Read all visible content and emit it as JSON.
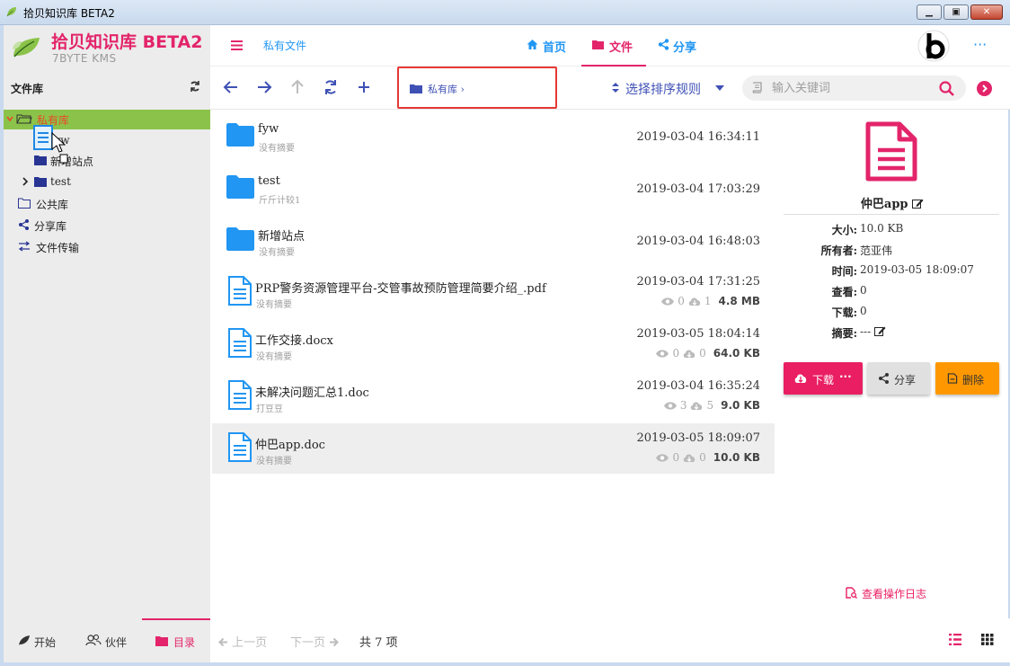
{
  "window": {
    "title": "拾贝知识库 BETA2",
    "minimize": "▁",
    "maximize": "▣",
    "close": "✕"
  },
  "brand": {
    "name": "拾贝知识库 BETA2",
    "subtitle": "7BYTE KMS"
  },
  "sidebar": {
    "heading": "文件库",
    "tree": [
      {
        "label": "私有库",
        "selected": true
      },
      {
        "label": "fyw"
      },
      {
        "label": "新增站点"
      },
      {
        "label": "test"
      },
      {
        "label": "公共库"
      },
      {
        "label": "分享库"
      },
      {
        "label": "文件传输"
      }
    ],
    "bottom_tabs": [
      {
        "label": "开始"
      },
      {
        "label": "伙伴"
      },
      {
        "label": "目录",
        "active": true
      }
    ]
  },
  "header": {
    "breadcrumb": "私有文件",
    "tabs": [
      {
        "label": "首页"
      },
      {
        "label": "文件",
        "active": true
      },
      {
        "label": "分享"
      }
    ],
    "more": "···"
  },
  "toolbar": {
    "path": "私有库",
    "path_sep": "›",
    "sort_label": "选择排序规则",
    "search_placeholder": "输入关键词"
  },
  "files": [
    {
      "type": "folder",
      "name": "fyw",
      "desc": "没有摘要",
      "date": "2019-03-04 16:34:11"
    },
    {
      "type": "folder",
      "name": "test",
      "desc": "斤斤计较1",
      "date": "2019-03-04 17:03:29"
    },
    {
      "type": "folder",
      "name": "新增站点",
      "desc": "没有摘要",
      "date": "2019-03-04 16:48:03"
    },
    {
      "type": "doc",
      "name": "PRP警务资源管理平台-交管事故预防管理简要介绍_.pdf",
      "desc": "没有摘要",
      "date": "2019-03-04 17:31:25",
      "views": "0",
      "downloads": "1",
      "size": "4.8 MB"
    },
    {
      "type": "doc",
      "name": "工作交接.docx",
      "desc": "没有摘要",
      "date": "2019-03-05 18:04:14",
      "views": "0",
      "downloads": "0",
      "size": "64.0 KB"
    },
    {
      "type": "doc",
      "name": "未解决问题汇总1.doc",
      "desc": "打豆豆",
      "date": "2019-03-04 16:35:24",
      "views": "3",
      "downloads": "5",
      "size": "9.0 KB"
    },
    {
      "type": "doc",
      "name": "仲巴app.doc",
      "desc": "没有摘要",
      "date": "2019-03-05 18:09:07",
      "views": "0",
      "downloads": "0",
      "size": "10.0 KB",
      "selected": true
    }
  ],
  "detail": {
    "title": "仲巴app",
    "fields": [
      {
        "key": "大小:",
        "value": "10.0 KB"
      },
      {
        "key": "所有者:",
        "value": "范亚伟"
      },
      {
        "key": "时间:",
        "value": "2019-03-05 18:09:07"
      },
      {
        "key": "查看:",
        "value": "0"
      },
      {
        "key": "下载:",
        "value": "0"
      },
      {
        "key": "摘要:",
        "value": "---"
      }
    ],
    "download_label": "下载",
    "download_more": "···",
    "share_label": "分享",
    "delete_label": "删除",
    "log_link": "查看操作日志"
  },
  "footer": {
    "prev": "上一页",
    "next": "下一页",
    "count": "共 7 项"
  },
  "colors": {
    "accent": "#e3246a",
    "primary": "#2196f3",
    "indigo": "#3f51b5",
    "selected_tree": "#8bc34a",
    "warning": "#ff9800"
  }
}
